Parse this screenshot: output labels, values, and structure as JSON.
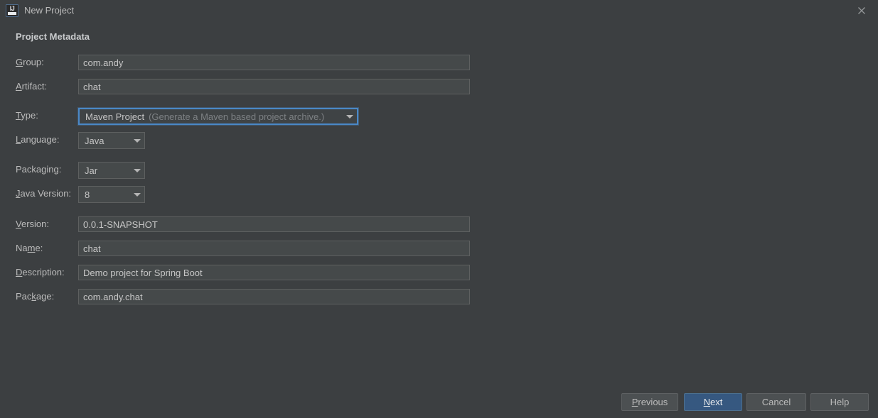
{
  "window": {
    "title": "New Project",
    "app_icon": "intellij-idea-icon",
    "icon_text": "IJ",
    "close_label": "close-icon"
  },
  "section": {
    "heading": "Project Metadata"
  },
  "fields": {
    "group": {
      "label_pre": "",
      "label_mnemonic": "G",
      "label_post": "roup:",
      "value": "com.andy"
    },
    "artifact": {
      "label_pre": "",
      "label_mnemonic": "A",
      "label_post": "rtifact:",
      "value": "chat"
    },
    "type": {
      "label_pre": "",
      "label_mnemonic": "T",
      "label_post": "ype:",
      "value": "Maven Project",
      "hint": "(Generate a Maven based project archive.)",
      "focused": true
    },
    "language": {
      "label_pre": "",
      "label_mnemonic": "L",
      "label_post": "anguage:",
      "value": "Java"
    },
    "packaging": {
      "label_pre": "Packa",
      "label_mnemonic": "g",
      "label_post": "ing:",
      "value": "Jar"
    },
    "java_version": {
      "label_pre": "",
      "label_mnemonic": "J",
      "label_post": "ava Version:",
      "value": "8"
    },
    "version": {
      "label_pre": "",
      "label_mnemonic": "V",
      "label_post": "ersion:",
      "value": "0.0.1-SNAPSHOT"
    },
    "name": {
      "label_pre": "Na",
      "label_mnemonic": "m",
      "label_post": "e:",
      "value": "chat"
    },
    "description": {
      "label_pre": "",
      "label_mnemonic": "D",
      "label_post": "escription:",
      "value": "Demo project for Spring Boot"
    },
    "package": {
      "label_pre": "Pac",
      "label_mnemonic": "k",
      "label_post": "age:",
      "value": "com.andy.chat"
    }
  },
  "buttons": {
    "previous": {
      "pre": "",
      "mnemonic": "P",
      "post": "revious"
    },
    "next": {
      "pre": "",
      "mnemonic": "N",
      "post": "ext"
    },
    "cancel": {
      "pre": "Cancel",
      "mnemonic": "",
      "post": ""
    },
    "help": {
      "pre": "Help",
      "mnemonic": "",
      "post": ""
    }
  },
  "colors": {
    "background": "#3c3f41",
    "field_background": "#45494a",
    "field_border": "#5e6060",
    "focus_border": "#4a88c7",
    "primary_button": "#365880",
    "text": "#bbbbbb",
    "hint_text": "#7d8184"
  }
}
